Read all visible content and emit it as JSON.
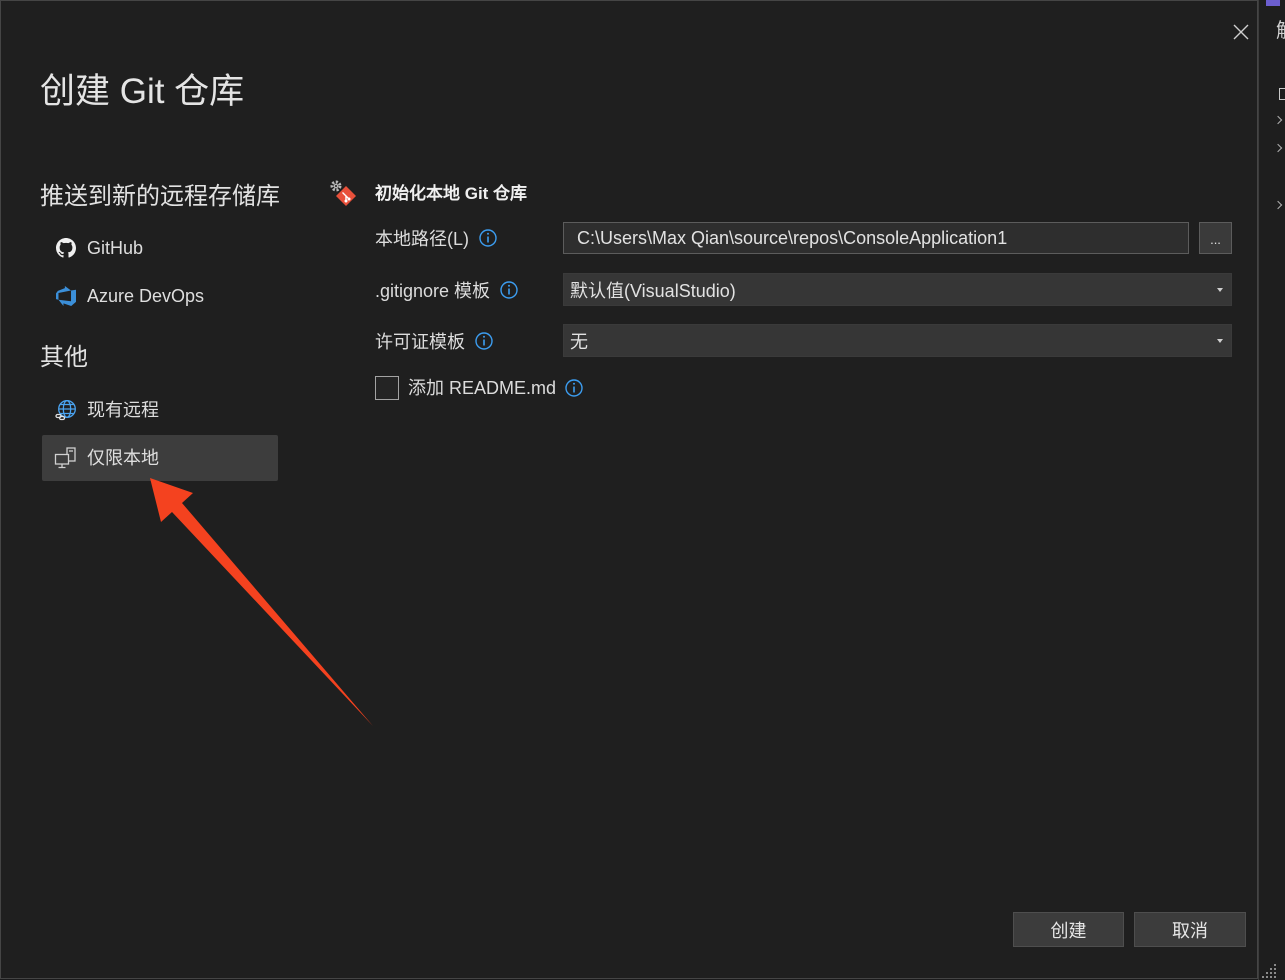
{
  "window": {
    "title": "创建 Git 仓库",
    "close_icon": "close-icon"
  },
  "sidebar": {
    "sections": [
      {
        "heading": "推送到新的远程存储库",
        "items": [
          {
            "label": "GitHub",
            "icon": "github-icon",
            "selected": false
          },
          {
            "label": "Azure DevOps",
            "icon": "azure-devops-icon",
            "selected": false
          }
        ]
      },
      {
        "heading": "其他",
        "items": [
          {
            "label": "现有远程",
            "icon": "globe-icon",
            "selected": false
          },
          {
            "label": "仅限本地",
            "icon": "local-computer-icon",
            "selected": true
          }
        ]
      }
    ]
  },
  "main": {
    "section_title": "初始化本地 Git 仓库",
    "section_icon": "git-icon",
    "fields": {
      "local_path": {
        "label": "本地路径(L)",
        "value": "C:\\Users\\Max Qian\\source\\repos\\ConsoleApplication1",
        "browse_label": "...",
        "info_icon": "info-icon"
      },
      "gitignore": {
        "label": ".gitignore 模板",
        "value": "默认值(VisualStudio)",
        "info_icon": "info-icon"
      },
      "license": {
        "label": "许可证模板",
        "value": "无",
        "info_icon": "info-icon"
      },
      "readme": {
        "label": "添加 README.md",
        "checked": false,
        "info_icon": "info-icon"
      }
    }
  },
  "footer": {
    "create_label": "创建",
    "cancel_label": "取消"
  },
  "background_window": {
    "partial_text": "解"
  },
  "colors": {
    "dialog_background": "#1f1f1f",
    "selected_item": "#3d3d3d",
    "info_accent": "#3c9df0",
    "git_orange": "#e8503a",
    "annotation_arrow": "#f4421f"
  }
}
